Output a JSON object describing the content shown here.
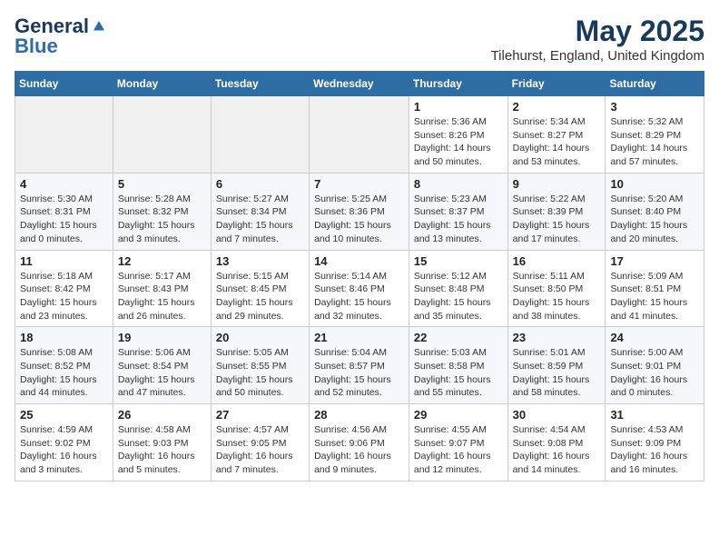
{
  "header": {
    "logo_general": "General",
    "logo_blue": "Blue",
    "month_title": "May 2025",
    "location": "Tilehurst, England, United Kingdom"
  },
  "days_of_week": [
    "Sunday",
    "Monday",
    "Tuesday",
    "Wednesday",
    "Thursday",
    "Friday",
    "Saturday"
  ],
  "weeks": [
    [
      {
        "day": "",
        "sunrise": "",
        "sunset": "",
        "daylight": ""
      },
      {
        "day": "",
        "sunrise": "",
        "sunset": "",
        "daylight": ""
      },
      {
        "day": "",
        "sunrise": "",
        "sunset": "",
        "daylight": ""
      },
      {
        "day": "",
        "sunrise": "",
        "sunset": "",
        "daylight": ""
      },
      {
        "day": "1",
        "sunrise": "Sunrise: 5:36 AM",
        "sunset": "Sunset: 8:26 PM",
        "daylight": "Daylight: 14 hours and 50 minutes."
      },
      {
        "day": "2",
        "sunrise": "Sunrise: 5:34 AM",
        "sunset": "Sunset: 8:27 PM",
        "daylight": "Daylight: 14 hours and 53 minutes."
      },
      {
        "day": "3",
        "sunrise": "Sunrise: 5:32 AM",
        "sunset": "Sunset: 8:29 PM",
        "daylight": "Daylight: 14 hours and 57 minutes."
      }
    ],
    [
      {
        "day": "4",
        "sunrise": "Sunrise: 5:30 AM",
        "sunset": "Sunset: 8:31 PM",
        "daylight": "Daylight: 15 hours and 0 minutes."
      },
      {
        "day": "5",
        "sunrise": "Sunrise: 5:28 AM",
        "sunset": "Sunset: 8:32 PM",
        "daylight": "Daylight: 15 hours and 3 minutes."
      },
      {
        "day": "6",
        "sunrise": "Sunrise: 5:27 AM",
        "sunset": "Sunset: 8:34 PM",
        "daylight": "Daylight: 15 hours and 7 minutes."
      },
      {
        "day": "7",
        "sunrise": "Sunrise: 5:25 AM",
        "sunset": "Sunset: 8:36 PM",
        "daylight": "Daylight: 15 hours and 10 minutes."
      },
      {
        "day": "8",
        "sunrise": "Sunrise: 5:23 AM",
        "sunset": "Sunset: 8:37 PM",
        "daylight": "Daylight: 15 hours and 13 minutes."
      },
      {
        "day": "9",
        "sunrise": "Sunrise: 5:22 AM",
        "sunset": "Sunset: 8:39 PM",
        "daylight": "Daylight: 15 hours and 17 minutes."
      },
      {
        "day": "10",
        "sunrise": "Sunrise: 5:20 AM",
        "sunset": "Sunset: 8:40 PM",
        "daylight": "Daylight: 15 hours and 20 minutes."
      }
    ],
    [
      {
        "day": "11",
        "sunrise": "Sunrise: 5:18 AM",
        "sunset": "Sunset: 8:42 PM",
        "daylight": "Daylight: 15 hours and 23 minutes."
      },
      {
        "day": "12",
        "sunrise": "Sunrise: 5:17 AM",
        "sunset": "Sunset: 8:43 PM",
        "daylight": "Daylight: 15 hours and 26 minutes."
      },
      {
        "day": "13",
        "sunrise": "Sunrise: 5:15 AM",
        "sunset": "Sunset: 8:45 PM",
        "daylight": "Daylight: 15 hours and 29 minutes."
      },
      {
        "day": "14",
        "sunrise": "Sunrise: 5:14 AM",
        "sunset": "Sunset: 8:46 PM",
        "daylight": "Daylight: 15 hours and 32 minutes."
      },
      {
        "day": "15",
        "sunrise": "Sunrise: 5:12 AM",
        "sunset": "Sunset: 8:48 PM",
        "daylight": "Daylight: 15 hours and 35 minutes."
      },
      {
        "day": "16",
        "sunrise": "Sunrise: 5:11 AM",
        "sunset": "Sunset: 8:50 PM",
        "daylight": "Daylight: 15 hours and 38 minutes."
      },
      {
        "day": "17",
        "sunrise": "Sunrise: 5:09 AM",
        "sunset": "Sunset: 8:51 PM",
        "daylight": "Daylight: 15 hours and 41 minutes."
      }
    ],
    [
      {
        "day": "18",
        "sunrise": "Sunrise: 5:08 AM",
        "sunset": "Sunset: 8:52 PM",
        "daylight": "Daylight: 15 hours and 44 minutes."
      },
      {
        "day": "19",
        "sunrise": "Sunrise: 5:06 AM",
        "sunset": "Sunset: 8:54 PM",
        "daylight": "Daylight: 15 hours and 47 minutes."
      },
      {
        "day": "20",
        "sunrise": "Sunrise: 5:05 AM",
        "sunset": "Sunset: 8:55 PM",
        "daylight": "Daylight: 15 hours and 50 minutes."
      },
      {
        "day": "21",
        "sunrise": "Sunrise: 5:04 AM",
        "sunset": "Sunset: 8:57 PM",
        "daylight": "Daylight: 15 hours and 52 minutes."
      },
      {
        "day": "22",
        "sunrise": "Sunrise: 5:03 AM",
        "sunset": "Sunset: 8:58 PM",
        "daylight": "Daylight: 15 hours and 55 minutes."
      },
      {
        "day": "23",
        "sunrise": "Sunrise: 5:01 AM",
        "sunset": "Sunset: 8:59 PM",
        "daylight": "Daylight: 15 hours and 58 minutes."
      },
      {
        "day": "24",
        "sunrise": "Sunrise: 5:00 AM",
        "sunset": "Sunset: 9:01 PM",
        "daylight": "Daylight: 16 hours and 0 minutes."
      }
    ],
    [
      {
        "day": "25",
        "sunrise": "Sunrise: 4:59 AM",
        "sunset": "Sunset: 9:02 PM",
        "daylight": "Daylight: 16 hours and 3 minutes."
      },
      {
        "day": "26",
        "sunrise": "Sunrise: 4:58 AM",
        "sunset": "Sunset: 9:03 PM",
        "daylight": "Daylight: 16 hours and 5 minutes."
      },
      {
        "day": "27",
        "sunrise": "Sunrise: 4:57 AM",
        "sunset": "Sunset: 9:05 PM",
        "daylight": "Daylight: 16 hours and 7 minutes."
      },
      {
        "day": "28",
        "sunrise": "Sunrise: 4:56 AM",
        "sunset": "Sunset: 9:06 PM",
        "daylight": "Daylight: 16 hours and 9 minutes."
      },
      {
        "day": "29",
        "sunrise": "Sunrise: 4:55 AM",
        "sunset": "Sunset: 9:07 PM",
        "daylight": "Daylight: 16 hours and 12 minutes."
      },
      {
        "day": "30",
        "sunrise": "Sunrise: 4:54 AM",
        "sunset": "Sunset: 9:08 PM",
        "daylight": "Daylight: 16 hours and 14 minutes."
      },
      {
        "day": "31",
        "sunrise": "Sunrise: 4:53 AM",
        "sunset": "Sunset: 9:09 PM",
        "daylight": "Daylight: 16 hours and 16 minutes."
      }
    ]
  ]
}
